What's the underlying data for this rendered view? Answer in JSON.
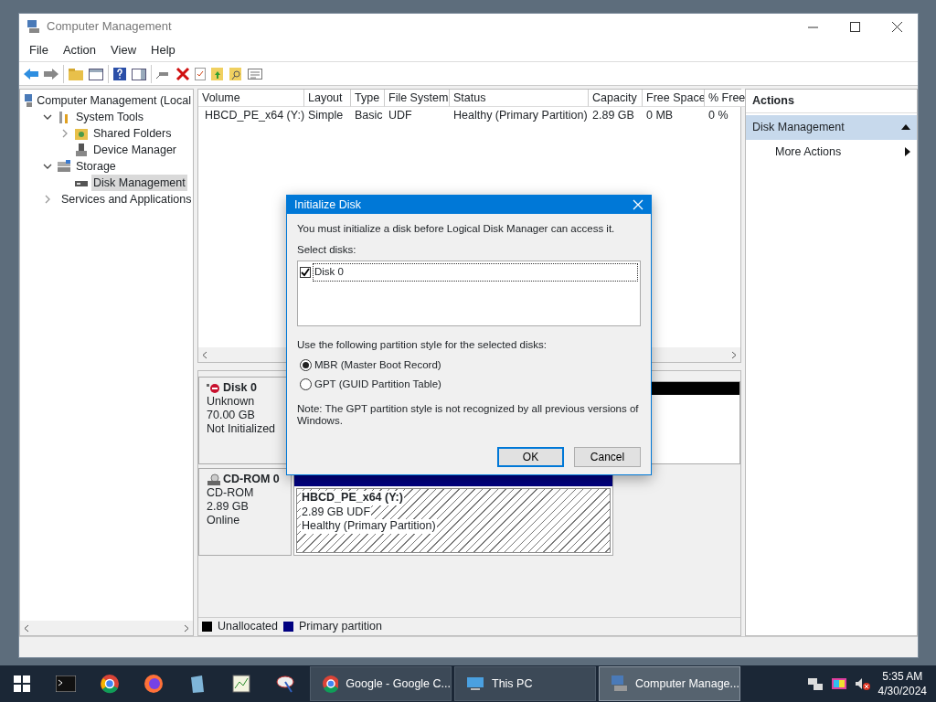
{
  "window": {
    "title": "Computer Management"
  },
  "menu": [
    "File",
    "Action",
    "View",
    "Help"
  ],
  "tree": [
    {
      "label": "Computer Management (Local",
      "selected": false,
      "children": [
        {
          "label": "System Tools",
          "expanded": true,
          "selected": false,
          "children": [
            {
              "label": "Shared Folders",
              "expanded": false,
              "selected": false
            },
            {
              "label": "Device Manager",
              "selected": false
            }
          ]
        },
        {
          "label": "Storage",
          "expanded": true,
          "selected": false,
          "children": [
            {
              "label": "Disk Management",
              "selected": true
            }
          ]
        },
        {
          "label": "Services and Applications",
          "expanded": false,
          "selected": false
        }
      ]
    }
  ],
  "volume_table": {
    "columns": [
      "Volume",
      "Layout",
      "Type",
      "File System",
      "Status",
      "Capacity",
      "Free Space",
      "% Free"
    ],
    "rows": [
      [
        "HBCD_PE_x64 (Y:)",
        "Simple",
        "Basic",
        "UDF",
        "Healthy (Primary Partition)",
        "2.89 GB",
        "0 MB",
        "0 %"
      ]
    ]
  },
  "disks": [
    {
      "kind": "disk",
      "name": "Disk 0",
      "lines": [
        "Unknown",
        "70.00 GB",
        "Not Initialized"
      ],
      "partitions": [
        {
          "kind": "unallocated",
          "color": "#000000"
        }
      ]
    },
    {
      "kind": "cdrom",
      "name": "CD-ROM 0",
      "lines": [
        "CD-ROM",
        "2.89 GB",
        "Online"
      ],
      "partitions": [
        {
          "kind": "primary",
          "color": "#000080",
          "name": "HBCD_PE_x64  (Y:)",
          "lines": [
            "2.89 GB UDF",
            "Healthy (Primary Partition)"
          ]
        }
      ]
    }
  ],
  "legend": [
    {
      "label": "Unallocated",
      "color": "#000000"
    },
    {
      "label": "Primary partition",
      "color": "#000080"
    }
  ],
  "actions": {
    "title": "Actions",
    "items": [
      {
        "kind": "section",
        "label": "Disk Management"
      },
      {
        "kind": "submenu",
        "label": "More Actions"
      }
    ]
  },
  "dialog": {
    "title": "Initialize Disk",
    "message": "You must initialize a disk before Logical Disk Manager can access it.",
    "select_label": "Select disks:",
    "disks": [
      {
        "label": "Disk 0",
        "checked": true
      }
    ],
    "style_label": "Use the following partition style for the selected disks:",
    "options": [
      {
        "label": "MBR (Master Boot Record)",
        "selected": true
      },
      {
        "label": "GPT (GUID Partition Table)",
        "selected": false
      }
    ],
    "note": "Note: The GPT partition style is not recognized by all previous versions of Windows.",
    "buttons": [
      {
        "label": "OK",
        "default": true
      },
      {
        "label": "Cancel",
        "default": false
      }
    ]
  },
  "taskbar": {
    "windows": [
      {
        "label": "Google - Google C...",
        "active": false
      },
      {
        "label": "This PC",
        "active": false
      },
      {
        "label": "Computer Manage...",
        "active": true
      }
    ],
    "time": "5:35 AM",
    "date": "4/30/2024"
  }
}
